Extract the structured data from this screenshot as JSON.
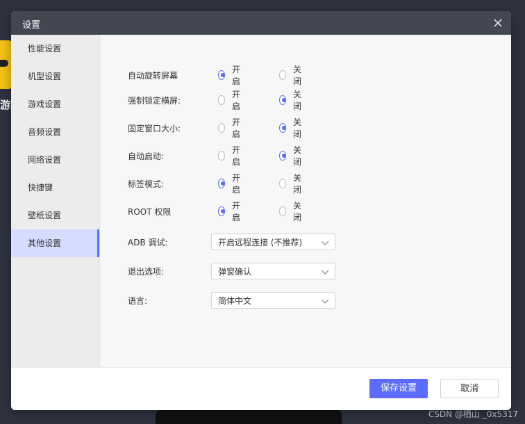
{
  "background": {
    "app_text": "游戏",
    "watermark": "CSDN @栖山 _0x5317"
  },
  "dialog": {
    "title": "设置",
    "close_icon": "close-icon"
  },
  "sidebar": {
    "items": [
      {
        "label": "性能设置",
        "active": false
      },
      {
        "label": "机型设置",
        "active": false
      },
      {
        "label": "游戏设置",
        "active": false
      },
      {
        "label": "音频设置",
        "active": false
      },
      {
        "label": "网络设置",
        "active": false
      },
      {
        "label": "快捷键",
        "active": false
      },
      {
        "label": "壁纸设置",
        "active": false
      },
      {
        "label": "其他设置",
        "active": true
      }
    ]
  },
  "settings": {
    "toggles": [
      {
        "label": "自动旋转屏幕",
        "on_label": "开启",
        "off_label": "关闭",
        "value": "on"
      },
      {
        "label": "强制锁定横屏:",
        "on_label": "开启",
        "off_label": "关闭",
        "value": "off"
      },
      {
        "label": "固定窗口大小:",
        "on_label": "开启",
        "off_label": "关闭",
        "value": "off"
      },
      {
        "label": "自动启动:",
        "on_label": "开启",
        "off_label": "关闭",
        "value": "off"
      },
      {
        "label": "标签模式:",
        "on_label": "开启",
        "off_label": "关闭",
        "value": "on"
      },
      {
        "label": "ROOT 权限",
        "on_label": "开启",
        "off_label": "关闭",
        "value": "on"
      }
    ],
    "selects": [
      {
        "label": "ADB 调试:",
        "value": "开启远程连接 (不推荐)"
      },
      {
        "label": "退出选项:",
        "value": "弹窗确认"
      },
      {
        "label": "语言:",
        "value": "简体中文"
      }
    ]
  },
  "footer": {
    "save_label": "保存设置",
    "cancel_label": "取消"
  },
  "colors": {
    "accent": "#5b6cff",
    "titlebar": "#434752",
    "active_nav": "#d6dcff"
  }
}
